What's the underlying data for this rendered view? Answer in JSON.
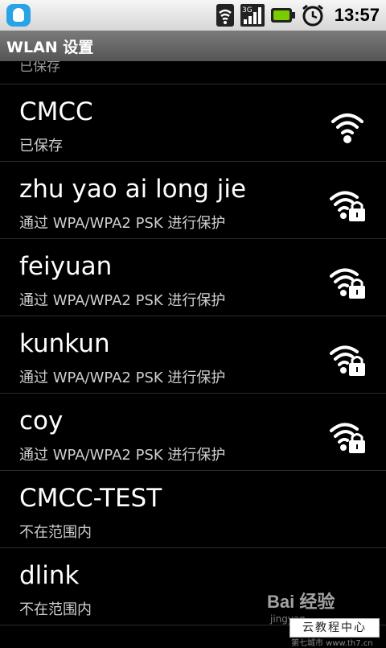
{
  "status_bar": {
    "time": "13:57",
    "icons": [
      "qq-icon",
      "wifi-signal-icon",
      "3g-signal-icon",
      "battery-icon",
      "alarm-clock-icon"
    ]
  },
  "header": {
    "title": "WLAN 设置"
  },
  "networks": [
    {
      "ssid": "",
      "status": "已保存",
      "icon": "none"
    },
    {
      "ssid": "CMCC",
      "status": "已保存",
      "icon": "wifi-open-icon"
    },
    {
      "ssid": "zhu yao ai long jie",
      "status": "通过 WPA/WPA2 PSK 进行保护",
      "icon": "wifi-locked-icon"
    },
    {
      "ssid": "feiyuan",
      "status": "通过 WPA/WPA2 PSK 进行保护",
      "icon": "wifi-locked-icon"
    },
    {
      "ssid": "kunkun",
      "status": "通过 WPA/WPA2 PSK 进行保护",
      "icon": "wifi-locked-icon"
    },
    {
      "ssid": "coy",
      "status": "通过 WPA/WPA2 PSK 进行保护",
      "icon": "wifi-locked-icon"
    },
    {
      "ssid": "CMCC-TEST",
      "status": "不在范围内",
      "icon": "none"
    },
    {
      "ssid": "dlink",
      "status": "不在范围内",
      "icon": "none"
    }
  ],
  "watermark": {
    "brand": "Bai 经验",
    "sub": "jingyan",
    "box": "云教程中心",
    "strip": "第七城市 www.th7.cn"
  }
}
